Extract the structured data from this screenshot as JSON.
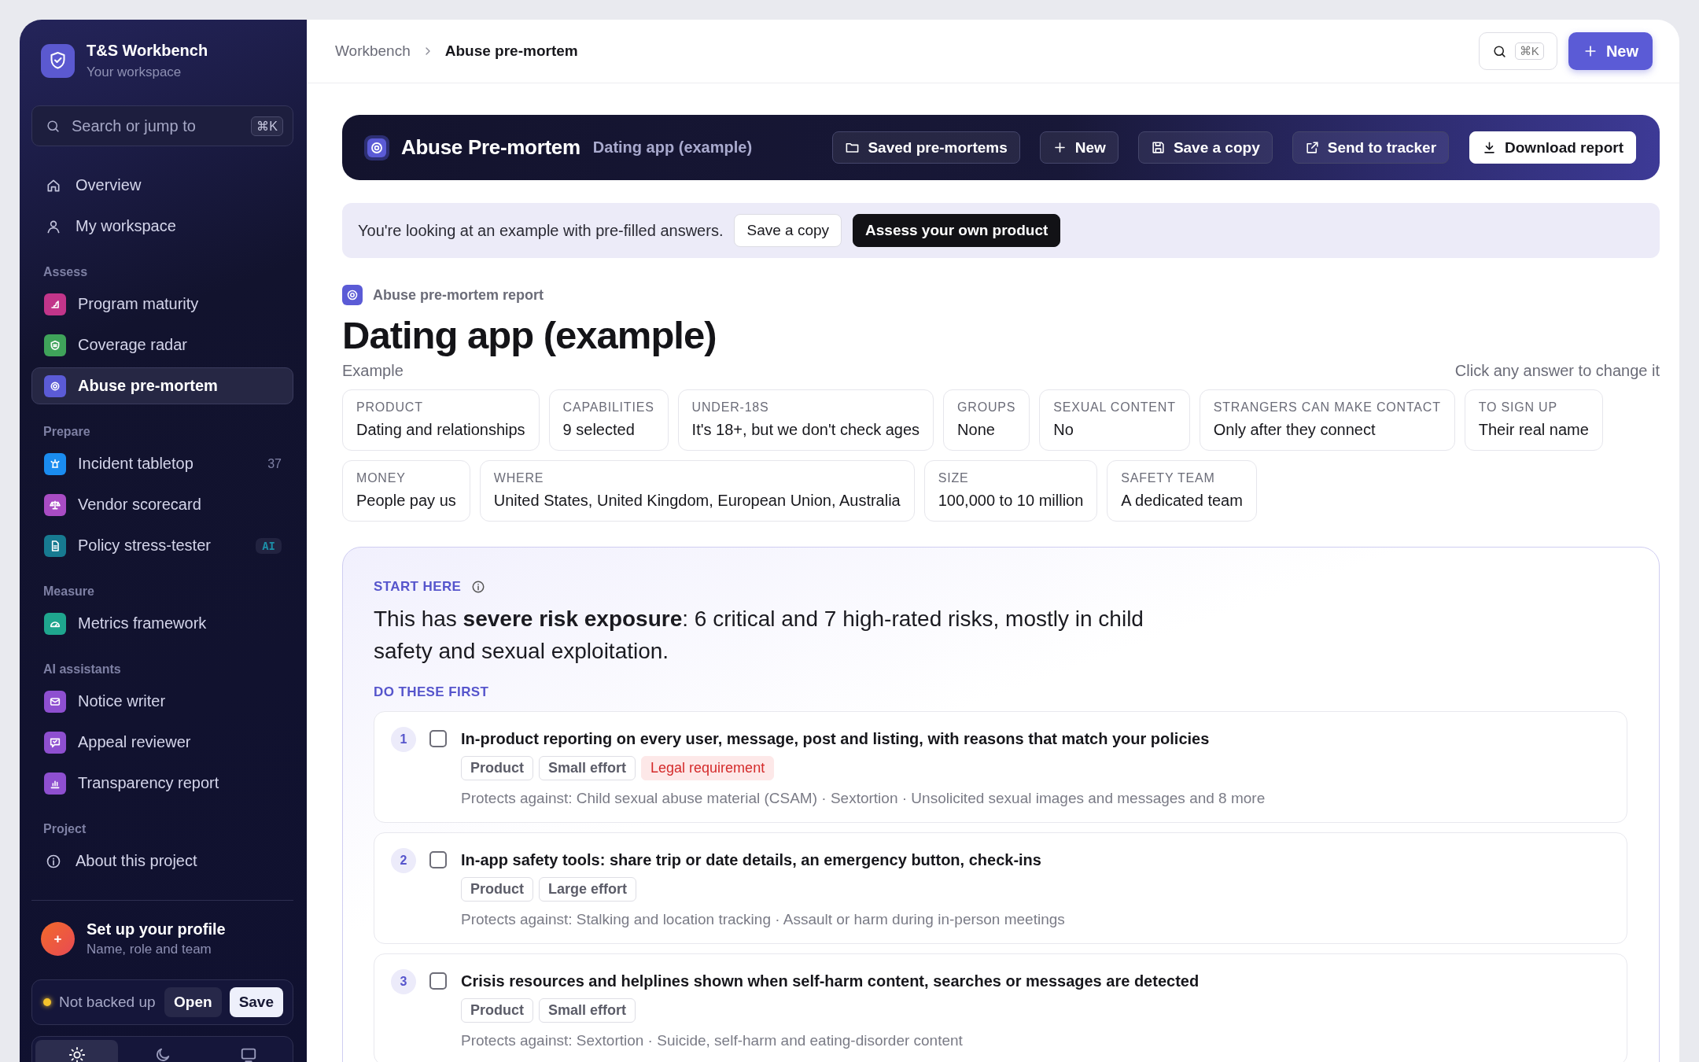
{
  "sidebar": {
    "brand": {
      "title": "T&S Workbench",
      "subtitle": "Your workspace"
    },
    "search": {
      "placeholder": "Search or jump to",
      "shortcut": "⌘K"
    },
    "sections": [
      {
        "items": [
          {
            "kind": "link",
            "label": "Overview",
            "selected": false
          },
          {
            "kind": "link",
            "label": "My workspace",
            "selected": false
          }
        ]
      },
      {
        "heading": "Assess",
        "items": [
          {
            "kind": "tool",
            "label": "Program maturity",
            "color": "#c2358a",
            "selected": false
          },
          {
            "kind": "tool",
            "label": "Coverage radar",
            "color": "#3fa35a",
            "selected": false
          },
          {
            "kind": "tool",
            "label": "Abuse pre-mortem",
            "color": "#5b5bd6",
            "selected": true
          }
        ]
      },
      {
        "heading": "Prepare",
        "items": [
          {
            "kind": "tool",
            "label": "Incident tabletop",
            "color": "#1a8cf0",
            "selected": false,
            "badge": {
              "kind": "count",
              "text": "37"
            }
          },
          {
            "kind": "tool",
            "label": "Vendor scorecard",
            "color": "#a94cc4",
            "selected": false
          },
          {
            "kind": "tool",
            "label": "Policy stress-tester",
            "color": "#177a91",
            "selected": false,
            "badge": {
              "kind": "tag",
              "text": "AI"
            }
          }
        ]
      },
      {
        "heading": "Measure",
        "items": [
          {
            "kind": "tool",
            "label": "Metrics framework",
            "color": "#1fa68e",
            "selected": false
          }
        ]
      },
      {
        "heading": "AI assistants",
        "items": [
          {
            "kind": "tool",
            "label": "Notice writer",
            "color": "#8e4fd0",
            "selected": false
          },
          {
            "kind": "tool",
            "label": "Appeal reviewer",
            "color": "#8e4fd0",
            "selected": false
          },
          {
            "kind": "tool",
            "label": "Transparency report",
            "color": "#8e4fd0",
            "selected": false
          }
        ]
      },
      {
        "heading": "Project",
        "items": [
          {
            "kind": "link",
            "label": "About this project",
            "selected": false
          }
        ]
      }
    ],
    "profile": {
      "avatar": "+",
      "title": "Set up your profile",
      "subtitle": "Name, role and team"
    },
    "backup": {
      "status": "Not backed up",
      "buttons": [
        "Open",
        "Save"
      ]
    },
    "theme_switch": [
      {
        "kind": "light",
        "selected": true
      },
      {
        "kind": "dark",
        "selected": false
      },
      {
        "kind": "system",
        "selected": false
      }
    ]
  },
  "topbar": {
    "breadcrumbs": [
      {
        "label": "Workbench",
        "selected": false
      },
      {
        "label": "Abuse pre-mortem",
        "selected": true
      }
    ],
    "search_shortcut": "⌘K",
    "new_button": "New"
  },
  "banner": {
    "title": "Abuse Pre-mortem",
    "subtitle": "Dating app (example)",
    "actions": [
      {
        "label": "Saved pre-mortems",
        "kind": "ghost"
      },
      {
        "label": "New",
        "kind": "ghost"
      },
      {
        "label": "Save a copy",
        "kind": "ghost"
      },
      {
        "label": "Send to tracker",
        "kind": "ghost"
      },
      {
        "label": "Download report",
        "kind": "primary"
      }
    ]
  },
  "notice": {
    "text": "You're looking at an example with pre-filled answers.",
    "buttons": [
      {
        "label": "Save a copy",
        "kind": "light"
      },
      {
        "label": "Assess your own product",
        "kind": "dark"
      }
    ]
  },
  "report": {
    "eyebrow": "Abuse pre-mortem report",
    "title": "Dating app (example)",
    "subtitle": "Example",
    "hint": "Click any answer to change it",
    "answer_rows": [
      [
        {
          "label": "PRODUCT",
          "value": "Dating and relationships"
        },
        {
          "label": "CAPABILITIES",
          "value": "9 selected"
        },
        {
          "label": "UNDER-18S",
          "value": "It's 18+, but we don't check ages"
        },
        {
          "label": "GROUPS",
          "value": "None"
        },
        {
          "label": "SEXUAL CONTENT",
          "value": "No"
        },
        {
          "label": "STRANGERS CAN MAKE CONTACT",
          "value": "Only after they connect"
        },
        {
          "label": "TO SIGN UP",
          "value": "Their real name"
        }
      ],
      [
        {
          "label": "MONEY",
          "value": "People pay us"
        },
        {
          "label": "WHERE",
          "value": "United States, United Kingdom, European Union, Australia"
        },
        {
          "label": "SIZE",
          "value": "100,000 to 10 million"
        },
        {
          "label": "SAFETY TEAM",
          "value": "A dedicated team"
        }
      ]
    ]
  },
  "summary": {
    "label": "START HERE",
    "text": "This has **severe risk exposure**: 6 critical and 7 high-rated risks, mostly in child safety and sexual exploitation.",
    "priority_label": "DO THESE FIRST",
    "actions": [
      {
        "number": "1",
        "title": "In-product reporting on every user, message, post and listing, with reasons that match your policies",
        "checked": false,
        "tags": [
          {
            "label": "Product",
            "kind": "plain"
          },
          {
            "label": "Small effort",
            "kind": "plain"
          },
          {
            "label": "Legal requirement",
            "kind": "warning"
          }
        ],
        "protects": "Protects against: Child sexual abuse material (CSAM) · Sextortion · Unsolicited sexual images and messages and 8 more"
      },
      {
        "number": "2",
        "title": "In-app safety tools: share trip or date details, an emergency button, check-ins",
        "checked": false,
        "tags": [
          {
            "label": "Product",
            "kind": "plain"
          },
          {
            "label": "Large effort",
            "kind": "plain"
          }
        ],
        "protects": "Protects against: Stalking and location tracking · Assault or harm during in-person meetings"
      },
      {
        "number": "3",
        "title": "Crisis resources and helplines shown when self-harm content, searches or messages are detected",
        "checked": false,
        "tags": [
          {
            "label": "Product",
            "kind": "plain"
          },
          {
            "label": "Small effort",
            "kind": "plain"
          }
        ],
        "protects": "Protects against: Sextortion · Suicide, self-harm and eating-disorder content"
      }
    ]
  }
}
